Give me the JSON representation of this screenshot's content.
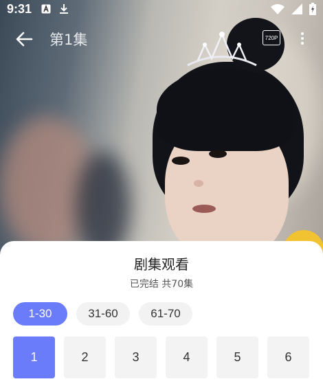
{
  "status_bar": {
    "time": "9:31",
    "icons_left": [
      "a-notification-icon",
      "download-icon"
    ],
    "icons_right": [
      "wifi-icon",
      "cell-signal-icon",
      "battery-icon"
    ]
  },
  "toolbar": {
    "title": "第1集",
    "quality_label": "720P"
  },
  "sheet": {
    "title": "剧集观看",
    "subtitle": "已完结 共70集",
    "range_tabs": [
      {
        "label": "1-30",
        "active": true
      },
      {
        "label": "31-60",
        "active": false
      },
      {
        "label": "61-70",
        "active": false
      }
    ],
    "episodes": [
      {
        "label": "1",
        "active": true
      },
      {
        "label": "2",
        "active": false
      },
      {
        "label": "3",
        "active": false
      },
      {
        "label": "4",
        "active": false
      },
      {
        "label": "5",
        "active": false
      },
      {
        "label": "6",
        "active": false
      }
    ]
  },
  "colors": {
    "accent": "#6b7cfa",
    "chip_bg": "#f2f2f2",
    "text_dark": "#222222"
  }
}
